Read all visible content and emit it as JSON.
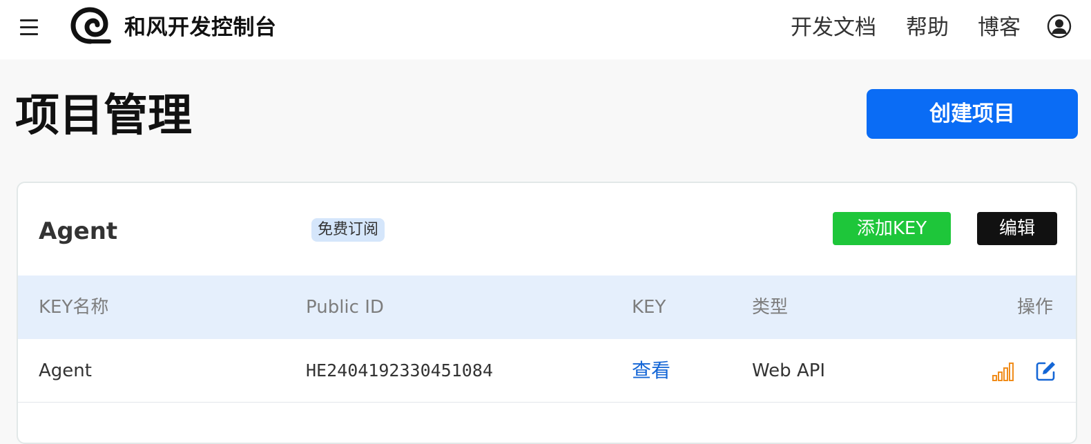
{
  "header": {
    "brand": "和风开发控制台",
    "nav": [
      "开发文档",
      "帮助",
      "博客"
    ]
  },
  "page": {
    "title": "项目管理",
    "create_button": "创建项目"
  },
  "project": {
    "name": "Agent",
    "plan_badge": "免费订阅",
    "add_key_button": "添加KEY",
    "edit_button": "编辑",
    "table": {
      "headers": [
        "KEY名称",
        "Public ID",
        "KEY",
        "类型",
        "操作"
      ],
      "rows": [
        {
          "key_name": "Agent",
          "public_id": "HE2404192330451084",
          "key_action": "查看",
          "type": "Web API",
          "actions": [
            "stats-icon",
            "edit-icon"
          ]
        }
      ]
    }
  },
  "colors": {
    "primary": "#0a6cf5",
    "success": "#1ec63a",
    "dark": "#111111",
    "table_header_bg": "#e5effc",
    "badge_bg": "#d5e6fb",
    "stats_icon": "#f08c1a",
    "link": "#1466d6"
  }
}
